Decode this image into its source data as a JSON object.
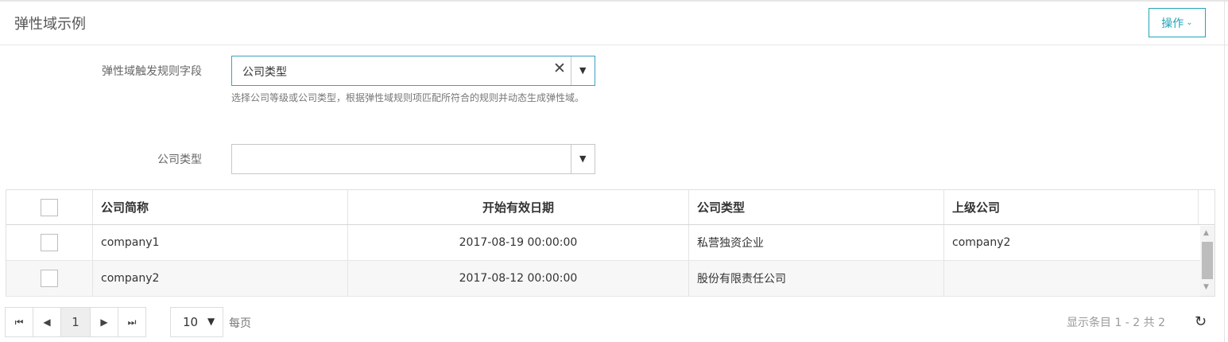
{
  "header": {
    "title": "弹性域示例",
    "ops_label": "操作"
  },
  "form": {
    "trigger_label": "弹性域触发规则字段",
    "trigger_value": "公司类型",
    "trigger_hint": "选择公司等级或公司类型，根据弹性域规则项匹配所符合的规则并动态生成弹性域。",
    "company_type_label": "公司类型",
    "company_type_value": ""
  },
  "grid": {
    "columns": [
      "公司简称",
      "开始有效日期",
      "公司类型",
      "上级公司"
    ],
    "rows": [
      {
        "name": "company1",
        "start_date": "2017-08-19 00:00:00",
        "type": "私营独资企业",
        "parent": "company2"
      },
      {
        "name": "company2",
        "start_date": "2017-08-12 00:00:00",
        "type": "股份有限责任公司",
        "parent": ""
      }
    ]
  },
  "pager": {
    "current_page": "1",
    "page_size": "10",
    "per_page_label": "每页",
    "summary": "显示条目 1 - 2 共 2"
  },
  "icons": {
    "first": "first-page-icon",
    "prev": "prev-page-icon",
    "next": "next-page-icon",
    "last": "last-page-icon",
    "refresh": "refresh-icon",
    "clear": "clear-icon",
    "dropdown": "dropdown-arrow-icon"
  },
  "colors": {
    "accent": "#21a4b6",
    "focus_border": "#3f9fc4"
  }
}
